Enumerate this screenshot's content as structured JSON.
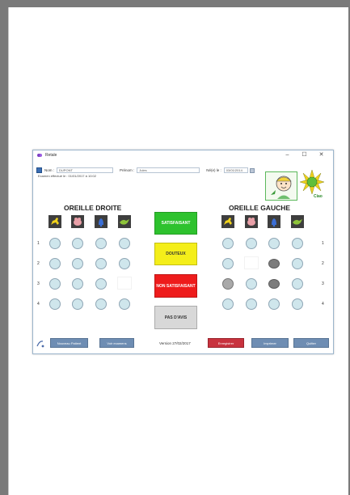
{
  "window": {
    "title": "Retale",
    "minimize": "–",
    "maximize": "☐",
    "close": "✕"
  },
  "patient": {
    "nom_label": "Nom :",
    "nom_value": "DUPONT",
    "prenom_label": "Prénom :",
    "prenom_value": "Jules",
    "dob_label": "Né(e) le :",
    "dob_value": "03/01/2014"
  },
  "exam_text": "Examen effectué le : 01/01/2017 à 10:02",
  "right": {
    "title": "OREILLE DROITE"
  },
  "left": {
    "title": "OREILLE GAUCHE"
  },
  "row_numbers": [
    "1",
    "2",
    "3",
    "4"
  ],
  "verdict": {
    "satisfaisant": "SATISFAISANT",
    "douteux": "DOUTEUX",
    "non_satisfaisant": "NON SATISFAISANT",
    "pas_avis": "PAS D'AVIS",
    "colors": {
      "satisfaisant": "#2ec22e",
      "douteux": "#f4ee1a",
      "non_satisfaisant": "#ee1c1c",
      "pas_avis": "#d8d8d8"
    }
  },
  "bottom": {
    "nouveau_patient": "Nouveau Patient",
    "voir_examens": "Voir examens",
    "version": "Version 27/02/2017",
    "enregistrer": "Enregistrer",
    "imprimer": "Imprimer",
    "quitter": "Quitter"
  },
  "icons": [
    "dog-icon",
    "pig-icon",
    "bell-icon",
    "bird-icon"
  ]
}
